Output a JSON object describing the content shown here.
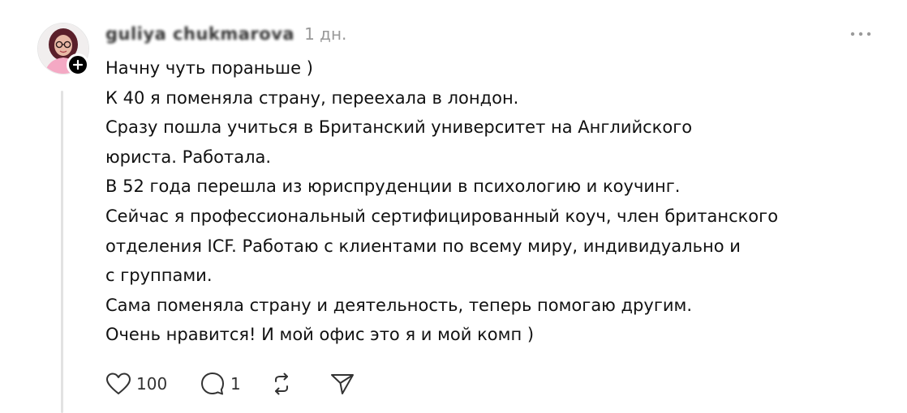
{
  "post": {
    "author": {
      "username": "guliya chukmarova",
      "avatar_icon": "user-avatar-photo"
    },
    "timestamp": "1 дн.",
    "more_icon": "more-horizontal-icon",
    "lines": [
      "Начну чуть пораньше )",
      "К 40 я поменяла страну, переехала в лондон.",
      "Сразу пошла учиться в Британский университет на Английского",
      "юриста. Работала.",
      "В 52 года перешла из юриспруденции в психологию и коучинг.",
      "Сейчас я профессиональный сертифицированный коуч, член британского",
      "отделения ICF. Работаю с клиентами по всему миру, индивидуально и",
      "с группами.",
      "Сама поменяла страну и деятельность, теперь помогаю другим.",
      "Очень нравится! И мой офис это я и мой комп )"
    ],
    "actions": {
      "likes": "100",
      "replies": "1",
      "icons": {
        "like": "heart-icon",
        "reply": "comment-icon",
        "repost": "repost-icon",
        "share": "send-icon"
      }
    }
  },
  "colors": {
    "text": "#111111",
    "muted": "#999999",
    "thread_line": "#e2e2e2",
    "follow_badge": "#000000"
  }
}
